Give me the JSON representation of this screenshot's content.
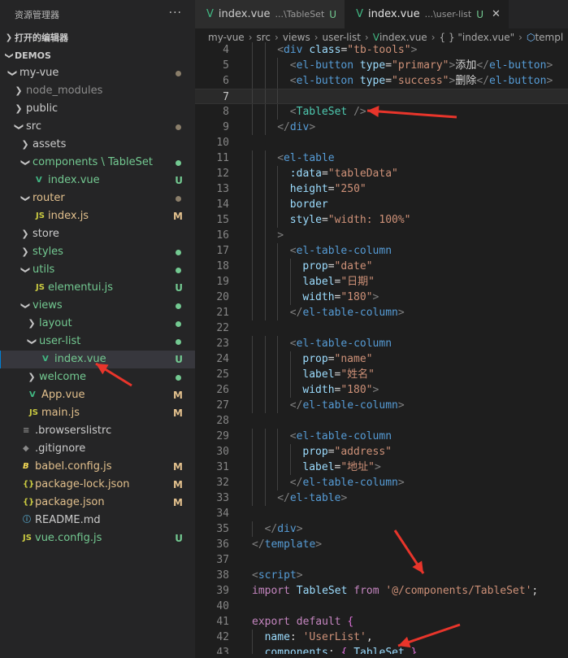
{
  "explorer": {
    "title": "资源管理器",
    "more": "···",
    "open_editors": "打开的编辑器",
    "workspace": "DEMOS",
    "tree": [
      {
        "label": "my-vue",
        "depth": 1,
        "type": "folder",
        "open": true,
        "dot": "#8a7e6a"
      },
      {
        "label": "node_modules",
        "depth": 2,
        "type": "folder",
        "open": false,
        "color": "#8c8c8c"
      },
      {
        "label": "public",
        "depth": 2,
        "type": "folder",
        "open": false
      },
      {
        "label": "src",
        "depth": 2,
        "type": "folder",
        "open": true,
        "dot": "#8a7e6a"
      },
      {
        "label": "assets",
        "depth": 3,
        "type": "folder",
        "open": false
      },
      {
        "label": "components \\ TableSet",
        "depth": 3,
        "type": "folder",
        "open": true,
        "color": "#73c991",
        "dot": "#73c991"
      },
      {
        "label": "index.vue",
        "depth": 4,
        "type": "vue",
        "color": "#73c991",
        "badge": "U",
        "badge_color": "#73c991"
      },
      {
        "label": "router",
        "depth": 3,
        "type": "folder",
        "open": true,
        "color": "#e2c08d",
        "dot": "#8a7e6a"
      },
      {
        "label": "index.js",
        "depth": 4,
        "type": "js",
        "color": "#e2c08d",
        "badge": "M",
        "badge_color": "#e2c08d"
      },
      {
        "label": "store",
        "depth": 3,
        "type": "folder",
        "open": false
      },
      {
        "label": "styles",
        "depth": 3,
        "type": "folder",
        "open": false,
        "color": "#73c991",
        "dot": "#73c991"
      },
      {
        "label": "utils",
        "depth": 3,
        "type": "folder",
        "open": true,
        "color": "#73c991",
        "dot": "#73c991"
      },
      {
        "label": "elementui.js",
        "depth": 4,
        "type": "js",
        "color": "#73c991",
        "badge": "U",
        "badge_color": "#73c991"
      },
      {
        "label": "views",
        "depth": 3,
        "type": "folder",
        "open": true,
        "color": "#73c991",
        "dot": "#73c991"
      },
      {
        "label": "layout",
        "depth": 4,
        "type": "folder",
        "open": false,
        "color": "#73c991",
        "dot": "#73c991"
      },
      {
        "label": "user-list",
        "depth": 4,
        "type": "folder",
        "open": true,
        "color": "#73c991",
        "dot": "#73c991"
      },
      {
        "label": "index.vue",
        "depth": 5,
        "type": "vue",
        "color": "#73c991",
        "badge": "U",
        "badge_color": "#73c991",
        "selected": true
      },
      {
        "label": "welcome",
        "depth": 4,
        "type": "folder",
        "open": false,
        "color": "#73c991",
        "dot": "#73c991"
      },
      {
        "label": "App.vue",
        "depth": 3,
        "type": "vue",
        "color": "#e2c08d",
        "badge": "M",
        "badge_color": "#e2c08d"
      },
      {
        "label": "main.js",
        "depth": 3,
        "type": "js",
        "color": "#e2c08d",
        "badge": "M",
        "badge_color": "#e2c08d"
      },
      {
        "label": ".browserslistrc",
        "depth": 2,
        "type": "list"
      },
      {
        "label": ".gitignore",
        "depth": 2,
        "type": "git"
      },
      {
        "label": "babel.config.js",
        "depth": 2,
        "type": "babel",
        "color": "#e2c08d",
        "badge": "M",
        "badge_color": "#e2c08d"
      },
      {
        "label": "package-lock.json",
        "depth": 2,
        "type": "json",
        "color": "#e2c08d",
        "badge": "M",
        "badge_color": "#e2c08d"
      },
      {
        "label": "package.json",
        "depth": 2,
        "type": "json",
        "color": "#e2c08d",
        "badge": "M",
        "badge_color": "#e2c08d"
      },
      {
        "label": "README.md",
        "depth": 2,
        "type": "info"
      },
      {
        "label": "vue.config.js",
        "depth": 2,
        "type": "js",
        "color": "#73c991",
        "badge": "U",
        "badge_color": "#73c991"
      }
    ]
  },
  "tabs": [
    {
      "label": "index.vue",
      "desc": "...\\TableSet",
      "badge": "U",
      "active": false
    },
    {
      "label": "index.vue",
      "desc": "...\\user-list",
      "badge": "U",
      "active": true,
      "close": "✕"
    }
  ],
  "breadcrumbs": [
    "my-vue",
    "src",
    "views",
    "user-list",
    "index.vue",
    "{ } \"index.vue\"",
    "templ"
  ],
  "current_line": 7,
  "code": [
    {
      "n": 4,
      "indent": 2,
      "tokens": [
        [
          "t-ang",
          "<"
        ],
        [
          "t-tag",
          "div"
        ],
        [
          "t-def",
          " "
        ],
        [
          "t-attr",
          "class"
        ],
        [
          "t-def",
          "="
        ],
        [
          "t-str",
          "\"tb-tools\""
        ],
        [
          "t-ang",
          ">"
        ]
      ]
    },
    {
      "n": 5,
      "indent": 3,
      "tokens": [
        [
          "t-ang",
          "<"
        ],
        [
          "t-tag",
          "el-button"
        ],
        [
          "t-def",
          " "
        ],
        [
          "t-attr",
          "type"
        ],
        [
          "t-def",
          "="
        ],
        [
          "t-str",
          "\"primary\""
        ],
        [
          "t-ang",
          ">"
        ],
        [
          "t-def",
          "添加"
        ],
        [
          "t-ang",
          "</"
        ],
        [
          "t-tag",
          "el-button"
        ],
        [
          "t-ang",
          ">"
        ]
      ]
    },
    {
      "n": 6,
      "indent": 3,
      "tokens": [
        [
          "t-ang",
          "<"
        ],
        [
          "t-tag",
          "el-button"
        ],
        [
          "t-def",
          " "
        ],
        [
          "t-attr",
          "type"
        ],
        [
          "t-def",
          "="
        ],
        [
          "t-str",
          "\"success\""
        ],
        [
          "t-ang",
          ">"
        ],
        [
          "t-def",
          "删除"
        ],
        [
          "t-ang",
          "</"
        ],
        [
          "t-tag",
          "el-button"
        ],
        [
          "t-ang",
          ">"
        ]
      ]
    },
    {
      "n": 7,
      "indent": 3,
      "tokens": []
    },
    {
      "n": 8,
      "indent": 3,
      "tokens": [
        [
          "t-ang",
          "<"
        ],
        [
          "t-cls",
          "TableSet"
        ],
        [
          "t-def",
          " "
        ],
        [
          "t-ang",
          "/>"
        ]
      ]
    },
    {
      "n": 9,
      "indent": 2,
      "tokens": [
        [
          "t-ang",
          "</"
        ],
        [
          "t-tag",
          "div"
        ],
        [
          "t-ang",
          ">"
        ]
      ]
    },
    {
      "n": 10,
      "indent": 0,
      "tokens": []
    },
    {
      "n": 11,
      "indent": 2,
      "tokens": [
        [
          "t-ang",
          "<"
        ],
        [
          "t-tag",
          "el-table"
        ]
      ]
    },
    {
      "n": 12,
      "indent": 3,
      "tokens": [
        [
          "t-attr",
          ":data"
        ],
        [
          "t-def",
          "="
        ],
        [
          "t-str",
          "\"tableData\""
        ]
      ]
    },
    {
      "n": 13,
      "indent": 3,
      "tokens": [
        [
          "t-attr",
          "height"
        ],
        [
          "t-def",
          "="
        ],
        [
          "t-str",
          "\"250\""
        ]
      ]
    },
    {
      "n": 14,
      "indent": 3,
      "tokens": [
        [
          "t-attr",
          "border"
        ]
      ]
    },
    {
      "n": 15,
      "indent": 3,
      "tokens": [
        [
          "t-attr",
          "style"
        ],
        [
          "t-def",
          "="
        ],
        [
          "t-str",
          "\"width: 100%\""
        ]
      ]
    },
    {
      "n": 16,
      "indent": 2,
      "tokens": [
        [
          "t-ang",
          ">"
        ]
      ]
    },
    {
      "n": 17,
      "indent": 3,
      "tokens": [
        [
          "t-ang",
          "<"
        ],
        [
          "t-tag",
          "el-table-column"
        ]
      ]
    },
    {
      "n": 18,
      "indent": 4,
      "tokens": [
        [
          "t-attr",
          "prop"
        ],
        [
          "t-def",
          "="
        ],
        [
          "t-str",
          "\"date\""
        ]
      ]
    },
    {
      "n": 19,
      "indent": 4,
      "tokens": [
        [
          "t-attr",
          "label"
        ],
        [
          "t-def",
          "="
        ],
        [
          "t-str",
          "\"日期\""
        ]
      ]
    },
    {
      "n": 20,
      "indent": 4,
      "tokens": [
        [
          "t-attr",
          "width"
        ],
        [
          "t-def",
          "="
        ],
        [
          "t-str",
          "\"180\""
        ],
        [
          "t-ang",
          ">"
        ]
      ]
    },
    {
      "n": 21,
      "indent": 3,
      "tokens": [
        [
          "t-ang",
          "</"
        ],
        [
          "t-tag",
          "el-table-column"
        ],
        [
          "t-ang",
          ">"
        ]
      ]
    },
    {
      "n": 22,
      "indent": 0,
      "tokens": []
    },
    {
      "n": 23,
      "indent": 3,
      "tokens": [
        [
          "t-ang",
          "<"
        ],
        [
          "t-tag",
          "el-table-column"
        ]
      ]
    },
    {
      "n": 24,
      "indent": 4,
      "tokens": [
        [
          "t-attr",
          "prop"
        ],
        [
          "t-def",
          "="
        ],
        [
          "t-str",
          "\"name\""
        ]
      ]
    },
    {
      "n": 25,
      "indent": 4,
      "tokens": [
        [
          "t-attr",
          "label"
        ],
        [
          "t-def",
          "="
        ],
        [
          "t-str",
          "\"姓名\""
        ]
      ]
    },
    {
      "n": 26,
      "indent": 4,
      "tokens": [
        [
          "t-attr",
          "width"
        ],
        [
          "t-def",
          "="
        ],
        [
          "t-str",
          "\"180\""
        ],
        [
          "t-ang",
          ">"
        ]
      ]
    },
    {
      "n": 27,
      "indent": 3,
      "tokens": [
        [
          "t-ang",
          "</"
        ],
        [
          "t-tag",
          "el-table-column"
        ],
        [
          "t-ang",
          ">"
        ]
      ]
    },
    {
      "n": 28,
      "indent": 0,
      "tokens": []
    },
    {
      "n": 29,
      "indent": 3,
      "tokens": [
        [
          "t-ang",
          "<"
        ],
        [
          "t-tag",
          "el-table-column"
        ]
      ]
    },
    {
      "n": 30,
      "indent": 4,
      "tokens": [
        [
          "t-attr",
          "prop"
        ],
        [
          "t-def",
          "="
        ],
        [
          "t-str",
          "\"address\""
        ]
      ]
    },
    {
      "n": 31,
      "indent": 4,
      "tokens": [
        [
          "t-attr",
          "label"
        ],
        [
          "t-def",
          "="
        ],
        [
          "t-str",
          "\"地址\""
        ],
        [
          "t-ang",
          ">"
        ]
      ]
    },
    {
      "n": 32,
      "indent": 3,
      "tokens": [
        [
          "t-ang",
          "</"
        ],
        [
          "t-tag",
          "el-table-column"
        ],
        [
          "t-ang",
          ">"
        ]
      ]
    },
    {
      "n": 33,
      "indent": 2,
      "tokens": [
        [
          "t-ang",
          "</"
        ],
        [
          "t-tag",
          "el-table"
        ],
        [
          "t-ang",
          ">"
        ]
      ]
    },
    {
      "n": 34,
      "indent": 0,
      "tokens": []
    },
    {
      "n": 35,
      "indent": 1,
      "tokens": [
        [
          "t-ang",
          "</"
        ],
        [
          "t-tag",
          "div"
        ],
        [
          "t-ang",
          ">"
        ]
      ]
    },
    {
      "n": 36,
      "indent": 0,
      "tokens": [
        [
          "t-ang",
          "</"
        ],
        [
          "t-tag",
          "template"
        ],
        [
          "t-ang",
          ">"
        ]
      ]
    },
    {
      "n": 37,
      "indent": 0,
      "tokens": []
    },
    {
      "n": 38,
      "indent": 0,
      "tokens": [
        [
          "t-ang",
          "<"
        ],
        [
          "t-tag",
          "script"
        ],
        [
          "t-ang",
          ">"
        ]
      ]
    },
    {
      "n": 39,
      "indent": 0,
      "tokens": [
        [
          "t-kw",
          "import"
        ],
        [
          "t-def",
          " "
        ],
        [
          "t-var",
          "TableSet"
        ],
        [
          "t-def",
          " "
        ],
        [
          "t-kw",
          "from"
        ],
        [
          "t-def",
          " "
        ],
        [
          "t-str",
          "'@/components/TableSet'"
        ],
        [
          "t-punc",
          ";"
        ]
      ]
    },
    {
      "n": 40,
      "indent": 0,
      "tokens": []
    },
    {
      "n": 41,
      "indent": 0,
      "tokens": [
        [
          "t-kw",
          "export"
        ],
        [
          "t-def",
          " "
        ],
        [
          "t-kw",
          "default"
        ],
        [
          "t-def",
          " "
        ],
        [
          "t-brace",
          "{"
        ]
      ]
    },
    {
      "n": 42,
      "indent": 1,
      "tokens": [
        [
          "t-var",
          "name"
        ],
        [
          "t-punc",
          ": "
        ],
        [
          "t-str",
          "'UserList'"
        ],
        [
          "t-punc",
          ","
        ]
      ]
    },
    {
      "n": 43,
      "indent": 1,
      "tokens": [
        [
          "t-var",
          "components"
        ],
        [
          "t-punc",
          ": "
        ],
        [
          "t-brace",
          "{ "
        ],
        [
          "t-var",
          "TableSet"
        ],
        [
          "t-def",
          " "
        ],
        [
          "t-brace",
          "}"
        ],
        [
          "t-punc",
          ","
        ]
      ]
    }
  ],
  "annotation_color": "#e8352b"
}
